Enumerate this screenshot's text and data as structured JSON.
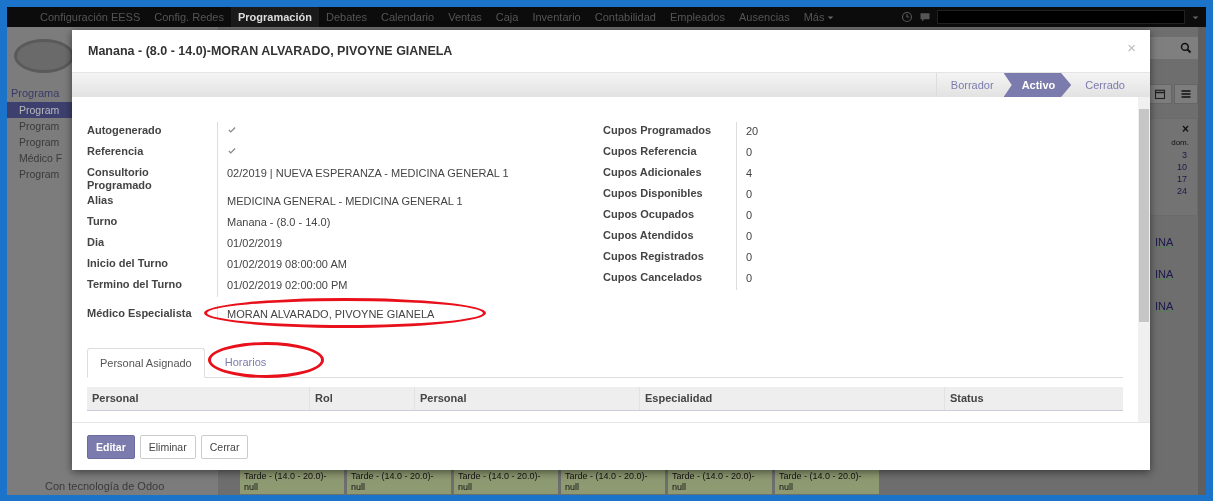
{
  "top_menu": [
    {
      "label": "Configuración EESS",
      "selected": false
    },
    {
      "label": "Config. Redes",
      "selected": false
    },
    {
      "label": "Programación",
      "selected": true
    },
    {
      "label": "Debates",
      "selected": false
    },
    {
      "label": "Calendario",
      "selected": false
    },
    {
      "label": "Ventas",
      "selected": false
    },
    {
      "label": "Caja",
      "selected": false
    },
    {
      "label": "Inventario",
      "selected": false
    },
    {
      "label": "Contabilidad",
      "selected": false
    },
    {
      "label": "Empleados",
      "selected": false
    },
    {
      "label": "Ausencias",
      "selected": false
    },
    {
      "label": "Más",
      "selected": false
    }
  ],
  "sidebar": {
    "heading": "Programa",
    "items": [
      {
        "label": "Program",
        "selected": true
      },
      {
        "label": "Program",
        "selected": false
      },
      {
        "label": "Program",
        "selected": false
      },
      {
        "label": "Médico F",
        "selected": false
      },
      {
        "label": "Program",
        "selected": false
      }
    ],
    "footer": "Con tecnología de Odoo"
  },
  "mini_calendar": {
    "close_label": "×",
    "day_header": "dom.",
    "days": [
      "3",
      "10",
      "17",
      "24"
    ]
  },
  "side_events": [
    "INA",
    "INA",
    "INA"
  ],
  "bottom_events": [
    {
      "title": "Tarde - (14.0 - 20.0)-",
      "note": "null"
    },
    {
      "title": "Tarde - (14.0 - 20.0)-",
      "note": "null"
    },
    {
      "title": "Tarde - (14.0 - 20.0)-",
      "note": "null"
    },
    {
      "title": "Tarde - (14.0 - 20.0)-",
      "note": "null"
    },
    {
      "title": "Tarde - (14.0 - 20.0)-",
      "note": "null"
    },
    {
      "title": "Tarde - (14.0 - 20.0)-",
      "note": "null"
    }
  ],
  "dialog": {
    "title": "Manana - (8.0 - 14.0)-MORAN ALVARADO, PIVOYNE GIANELA",
    "close_label": "×",
    "stages": [
      {
        "label": "Borrador",
        "selected": false
      },
      {
        "label": "Activo",
        "selected": true
      },
      {
        "label": "Cerrado",
        "selected": false
      }
    ],
    "left_fields": [
      {
        "kind": "checkbox",
        "label": "Autogenerado",
        "checked": true,
        "circled": false
      },
      {
        "kind": "checkbox",
        "label": "Referencia",
        "checked": true,
        "circled": false
      },
      {
        "kind": "text",
        "label": "Consultorio Programado",
        "value": "02/2019 | NUEVA ESPERANZA - MEDICINA GENERAL 1",
        "circled": false
      },
      {
        "kind": "text",
        "label": "Alias",
        "value": "MEDICINA GENERAL - MEDICINA GENERAL 1",
        "circled": false
      },
      {
        "kind": "text",
        "label": "Turno",
        "value": "Manana - (8.0 - 14.0)",
        "circled": false
      },
      {
        "kind": "text",
        "label": "Dia",
        "value": "01/02/2019",
        "circled": false
      },
      {
        "kind": "text",
        "label": "Inicio del Turno",
        "value": "01/02/2019 08:00:00 AM",
        "circled": false
      },
      {
        "kind": "text",
        "label": "Termino del Turno",
        "value": "01/02/2019 02:00:00 PM",
        "circled": false
      },
      {
        "kind": "text",
        "label": "Médico Especialista",
        "value": "MORAN ALVARADO, PIVOYNE GIANELA",
        "circled": true
      }
    ],
    "right_fields": [
      {
        "label": "Cupos Programados",
        "value": "20"
      },
      {
        "label": "Cupos Referencia",
        "value": "0"
      },
      {
        "label": "Cupos Adicionales",
        "value": "4"
      },
      {
        "label": "Cupos Disponibles",
        "value": "0"
      },
      {
        "label": "Cupos Ocupados",
        "value": "0"
      },
      {
        "label": "Cupos Atendidos",
        "value": "0"
      },
      {
        "label": "Cupos Registrados",
        "value": "0"
      },
      {
        "label": "Cupos Cancelados",
        "value": "0"
      }
    ],
    "tabs": [
      {
        "label": "Personal Asignado",
        "selected": true,
        "circled": false
      },
      {
        "label": "Horarios",
        "selected": false,
        "circled": true
      }
    ],
    "table": {
      "columns": [
        "Personal",
        "Rol",
        "Personal",
        "Especialidad",
        "Status"
      ]
    },
    "buttons": [
      {
        "label": "Editar",
        "kind": "primary"
      },
      {
        "label": "Eliminar",
        "kind": "default"
      },
      {
        "label": "Cerrar",
        "kind": "default"
      }
    ]
  }
}
